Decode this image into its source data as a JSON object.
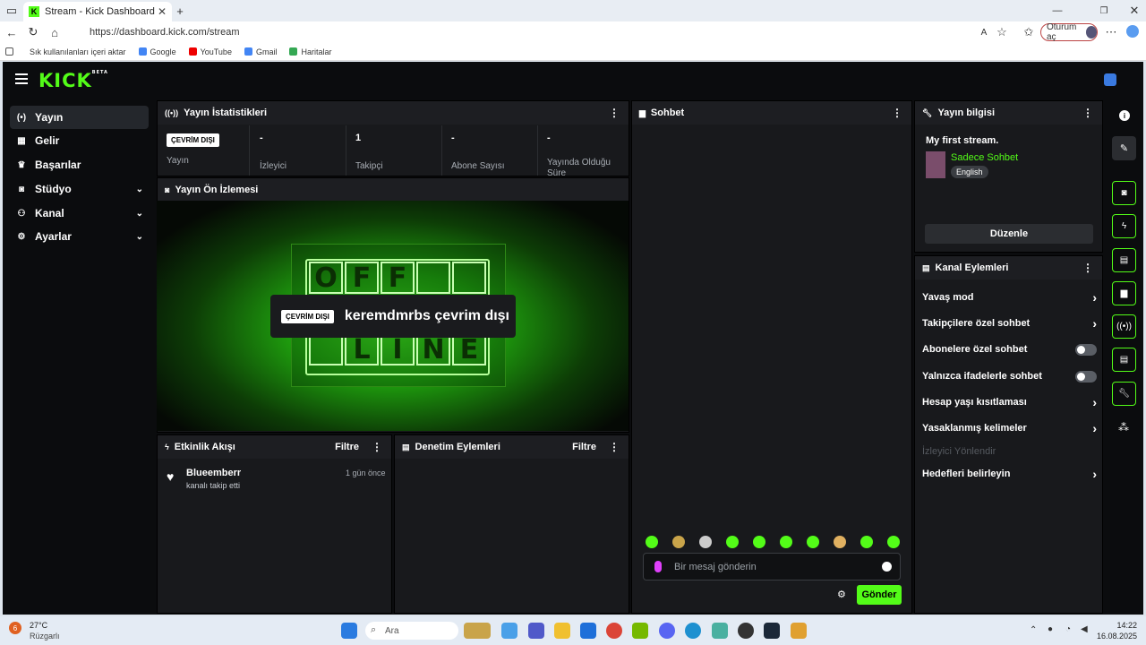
{
  "browser": {
    "tab_title": "Stream - Kick Dashboard",
    "tab_icon": "kick-icon",
    "url": "https://dashboard.kick.com/stream",
    "login_label": "Oturum aç",
    "bookmarks": [
      "Sık kullanılanları içeri aktar",
      "Google",
      "YouTube",
      "Gmail",
      "Haritalar"
    ]
  },
  "sidebar": {
    "items": [
      {
        "label": "Yayın",
        "icon": "broadcast-icon"
      },
      {
        "label": "Gelir",
        "icon": "revenue-icon"
      },
      {
        "label": "Başarılar",
        "icon": "trophy-icon"
      },
      {
        "label": "Stüdyo",
        "icon": "studio-icon"
      },
      {
        "label": "Kanal",
        "icon": "channel-icon"
      },
      {
        "label": "Ayarlar",
        "icon": "gear-icon"
      }
    ]
  },
  "stats": {
    "title": "Yayın İstatistikleri",
    "offline_badge": "ÇEVRİM DIŞI",
    "stream_label": "Yayın",
    "items": [
      {
        "value": "-",
        "label": "İzleyici"
      },
      {
        "value": "1",
        "label": "Takipçi"
      },
      {
        "value": "-",
        "label": "Abone Sayısı"
      },
      {
        "value": "-",
        "label": "Yayında Olduğu Süre"
      }
    ]
  },
  "preview": {
    "title": "Yayın Ön İzlemesi",
    "offline_badge": "ÇEVRİM DIŞI",
    "offline_text": "keremdmrbs çevrim dışı",
    "tile_top": [
      "O",
      "F",
      "F",
      ""
    ],
    "tile_bottom": [
      "",
      "L",
      "I",
      "N",
      "E"
    ]
  },
  "activity": {
    "title": "Etkinlik Akışı",
    "filter": "Filtre",
    "event_user": "Blueemberr",
    "event_text": "kanalı takip etti",
    "event_time": "1 gün önce"
  },
  "moderation": {
    "title": "Denetim Eylemleri",
    "filter": "Filtre"
  },
  "chat": {
    "title": "Sohbet",
    "placeholder": "Bir mesaj gönderin",
    "send": "Gönder"
  },
  "stream_info": {
    "title": "Yayın bilgisi",
    "stream_title": "My first stream.",
    "category": "Sadece Sohbet",
    "language": "English",
    "edit": "Düzenle"
  },
  "channel_actions": {
    "title": "Kanal Eylemleri",
    "items": [
      {
        "label": "Yavaş mod",
        "type": "chevron"
      },
      {
        "label": "Takipçilere özel sohbet",
        "type": "chevron"
      },
      {
        "label": "Abonelere özel sohbet",
        "type": "toggle"
      },
      {
        "label": "Yalnızca ifadelerle sohbet",
        "type": "toggle"
      },
      {
        "label": "Hesap yaşı kısıtlaması",
        "type": "chevron"
      },
      {
        "label": "Yasaklanmış kelimeler",
        "type": "chevron"
      },
      {
        "label": "İzleyici Yönlendir",
        "type": "disabled"
      },
      {
        "label": "Hedefleri belirleyin",
        "type": "chevron"
      }
    ]
  },
  "taskbar": {
    "weather_temp": "27°C",
    "weather_text": "Rüzgarlı",
    "weather_badge": "6",
    "search": "Ara",
    "time": "14:22",
    "date": "16.08.2025"
  },
  "colors": {
    "accent": "#53fc18",
    "background": "#0b0c0e",
    "panel": "#18191c"
  }
}
